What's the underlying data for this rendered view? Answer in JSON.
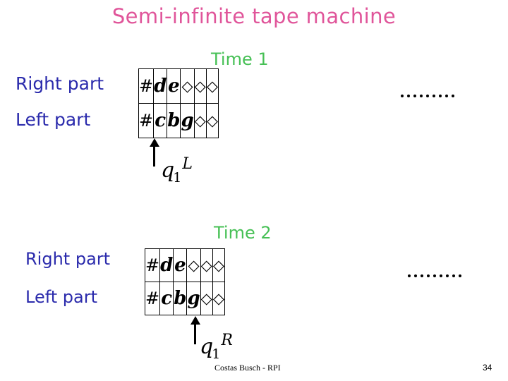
{
  "slide": {
    "title": "Semi-infinite tape machine",
    "title_color": "#e0559a"
  },
  "colors": {
    "title_pink": "#e0559a",
    "time_green": "#46c055",
    "label_blue": "#2b2bac",
    "ink_black": "#000000"
  },
  "sections": [
    {
      "time_label": "Time 1",
      "right_part_label": "Right part",
      "left_part_label": "Left part",
      "tape_right": [
        "#",
        "d",
        "e",
        "◇",
        "◇",
        "◇",
        ""
      ],
      "tape_left": [
        "#",
        "c",
        "b",
        "g",
        "◇",
        "◇",
        ""
      ],
      "head_cell_index": 0,
      "state": {
        "name": "q",
        "subscript": "1",
        "superscript": "L"
      },
      "ellipsis_dots": 9
    },
    {
      "time_label": "Time 2",
      "right_part_label": "Right part",
      "left_part_label": "Left part",
      "tape_right": [
        "#",
        "d",
        "e",
        "◇",
        "◇",
        "◇",
        ""
      ],
      "tape_left": [
        "#",
        "c",
        "b",
        "g",
        "◇",
        "◇",
        ""
      ],
      "head_cell_index": 1,
      "state": {
        "name": "q",
        "subscript": "1",
        "superscript": "R"
      },
      "ellipsis_dots": 9
    }
  ],
  "footer": {
    "credit": "Costas Busch - RPI",
    "page_number": "34"
  }
}
